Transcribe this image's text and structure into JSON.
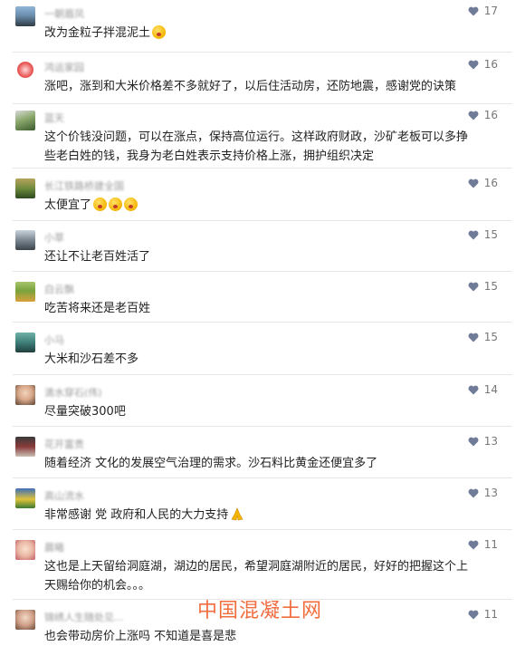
{
  "comments": [
    {
      "nick": "一朝眉凤",
      "text": "改为金粒子拌混泥土",
      "likes": "17",
      "emoji": "pensive"
    },
    {
      "nick": "鸿运家园",
      "text": "涨吧，涨到和大米价格差不多就好了，以后住活动房，还防地震，感谢党的诀策",
      "likes": "16"
    },
    {
      "nick": "蓝天",
      "text": "这个价钱没问题，可以在涨点，保持高位运行。这样政府财政，沙矿老板可以多挣些老白姓的钱，我身为老白姓表示支持价格上涨，拥护组织决定",
      "likes": "16"
    },
    {
      "nick": "长江铁路桥建全国",
      "text": "太便宜了",
      "likes": "16",
      "emoji": "shocked-x3"
    },
    {
      "nick": "小草",
      "text": "还让不让老百姓活了",
      "likes": "15"
    },
    {
      "nick": "白云飘",
      "text": "吃苦将来还是老百姓",
      "likes": "15"
    },
    {
      "nick": "小马",
      "text": "大米和沙石差不多",
      "likes": "15"
    },
    {
      "nick": "滴水穿石(伟)",
      "text": "尽量突破300吧",
      "likes": "14"
    },
    {
      "nick": "花开富贵",
      "text": "随着经济  文化的发展空气治理的需求。沙石料比黄金还便宜多了",
      "likes": "13"
    },
    {
      "nick": "高山流水",
      "text": "非常感谢 党  政府和人民的大力支持",
      "likes": "13",
      "emoji": "pray"
    },
    {
      "nick": "晨曦",
      "text": "这也是上天留给洞庭湖，湖边的居民，希望洞庭湖附近的居民，好好的把握这个上天赐给你的机会。。。",
      "likes": "11"
    },
    {
      "nick": "锦绣人生随处见...",
      "text": "也会带动房价上涨吗  不知道是喜是悲",
      "likes": "11"
    }
  ],
  "watermark": "中国混凝土网",
  "colors": {
    "heart": "#6f7b97",
    "divider": "#e6e6e6",
    "text": "#222222",
    "watermark": "#f15a24"
  }
}
